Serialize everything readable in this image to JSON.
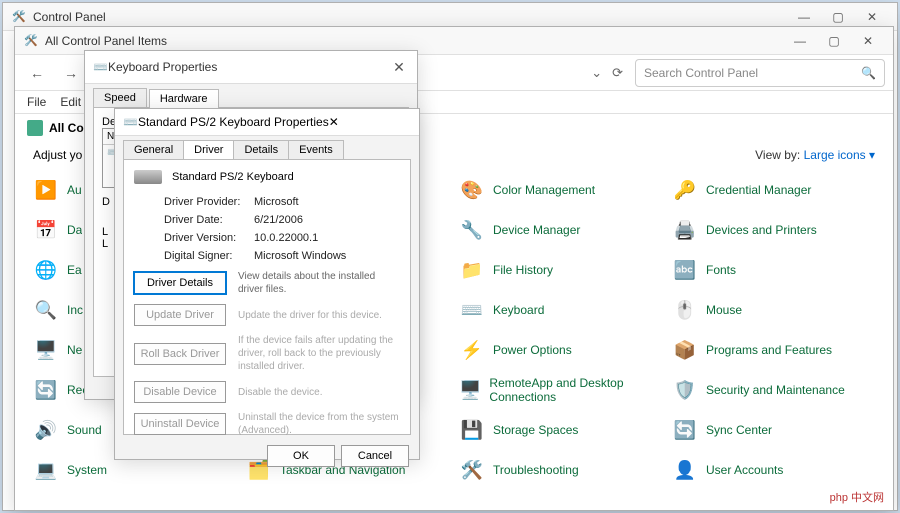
{
  "outer": {
    "title": "Control Panel"
  },
  "items_window": {
    "title": "All Control Panel Items",
    "search_placeholder": "Search Control Panel",
    "menu": [
      "File",
      "Edit"
    ],
    "breadcrumb": "All Contro",
    "adjust": "Adjust yo",
    "view_by_label": "View by:",
    "view_by_value": "Large icons ▾"
  },
  "grid": {
    "col1": [
      {
        "icon": "▶️",
        "label": "Au"
      },
      {
        "icon": "📅",
        "label": "Da"
      },
      {
        "icon": "🌐",
        "label": "Ea"
      },
      {
        "icon": "🔍",
        "label": "Inc"
      },
      {
        "icon": "🖥️",
        "label": "Ne Ce"
      },
      {
        "icon": "🔄",
        "label": "Recove"
      },
      {
        "icon": "🔊",
        "label": "Sound"
      },
      {
        "icon": "💻",
        "label": "System"
      }
    ],
    "col2": [
      {
        "icon": "🗂️",
        "label": "Taskbar and Navigation"
      }
    ],
    "col3": [
      {
        "icon": "🎨",
        "label": "Color Management"
      },
      {
        "icon": "🔧",
        "label": "Device Manager"
      },
      {
        "icon": "📁",
        "label": "File History"
      },
      {
        "icon": "⌨️",
        "label": "Keyboard"
      },
      {
        "icon": "⚡",
        "label": "Power Options"
      },
      {
        "icon": "🖥️",
        "label": "RemoteApp and Desktop Connections"
      },
      {
        "icon": "💾",
        "label": "Storage Spaces"
      },
      {
        "icon": "🛠️",
        "label": "Troubleshooting"
      }
    ],
    "col4": [
      {
        "icon": "🔑",
        "label": "Credential Manager"
      },
      {
        "icon": "🖨️",
        "label": "Devices and Printers"
      },
      {
        "icon": "🔤",
        "label": "Fonts"
      },
      {
        "icon": "🖱️",
        "label": "Mouse"
      },
      {
        "icon": "📦",
        "label": "Programs and Features"
      },
      {
        "icon": "🛡️",
        "label": "Security and Maintenance"
      },
      {
        "icon": "🔄",
        "label": "Sync Center"
      },
      {
        "icon": "👤",
        "label": "User Accounts"
      }
    ]
  },
  "kbprops": {
    "title": "Keyboard Properties",
    "tabs": [
      "Speed",
      "Hardware"
    ],
    "active_tab": 1,
    "devices_label": "De",
    "list_header": "N",
    "partial_letters": [
      "D",
      "L",
      "L"
    ]
  },
  "driverprops": {
    "title": "Standard PS/2 Keyboard Properties",
    "tabs": [
      "General",
      "Driver",
      "Details",
      "Events"
    ],
    "active_tab": 1,
    "device_name": "Standard PS/2 Keyboard",
    "rows": [
      {
        "label": "Driver Provider:",
        "value": "Microsoft"
      },
      {
        "label": "Driver Date:",
        "value": "6/21/2006"
      },
      {
        "label": "Driver Version:",
        "value": "10.0.22000.1"
      },
      {
        "label": "Digital Signer:",
        "value": "Microsoft Windows"
      }
    ],
    "buttons": [
      {
        "label": "Driver Details",
        "desc": "View details about the installed driver files.",
        "focus": true
      },
      {
        "label": "Update Driver",
        "desc": "Update the driver for this device.",
        "dim": true
      },
      {
        "label": "Roll Back Driver",
        "desc": "If the device fails after updating the driver, roll back to the previously installed driver.",
        "dim": true
      },
      {
        "label": "Disable Device",
        "desc": "Disable the device.",
        "dim": true
      },
      {
        "label": "Uninstall Device",
        "desc": "Uninstall the device from the system (Advanced).",
        "dim": true
      }
    ],
    "ok": "OK",
    "cancel": "Cancel"
  },
  "watermark": "php 中文网"
}
